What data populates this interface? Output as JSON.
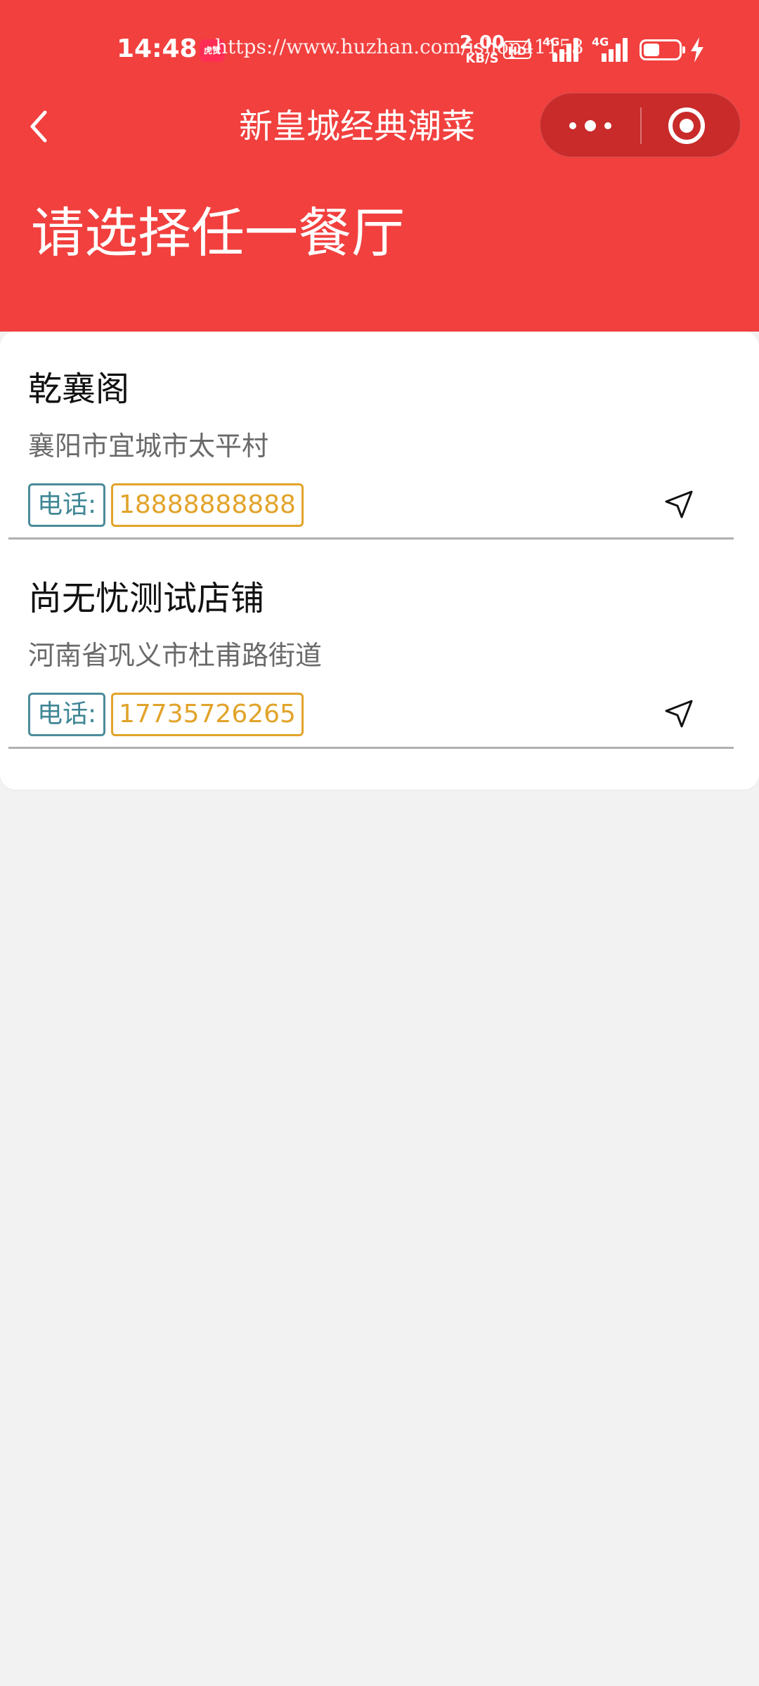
{
  "status_bar": {
    "time": "14:48",
    "app_badge": "虎赞",
    "watermark": "https://www.huzhan.com/ishop41153",
    "net_speed_value": "2.00",
    "net_speed_unit": "KB/S",
    "hd_label": "HD",
    "signal1_label": "4G",
    "signal2_label": "4G",
    "battery_level": 0.45
  },
  "nav": {
    "title": "新皇城经典潮菜",
    "back_icon": "chevron-left-icon",
    "more_icon": "more-dots-icon",
    "close_icon": "target-circle-icon"
  },
  "page": {
    "heading": "请选择任一餐厅"
  },
  "stores": [
    {
      "name": "乾襄阁",
      "address": "襄阳市宜城市太平村",
      "phone_label": "电话:",
      "phone": "18888888888",
      "nav_icon": "navigation-arrow-icon"
    },
    {
      "name": "尚无忧测试店铺",
      "address": "河南省巩义市杜甫路街道",
      "phone_label": "电话:",
      "phone": "17735726265",
      "nav_icon": "navigation-arrow-icon"
    }
  ],
  "colors": {
    "header_bg": "#f1403e",
    "capsule_bg": "#c92a2a",
    "page_bg": "#f2f2f2",
    "phone_label_color": "#3f8695",
    "phone_value_color": "#e2a32a"
  }
}
